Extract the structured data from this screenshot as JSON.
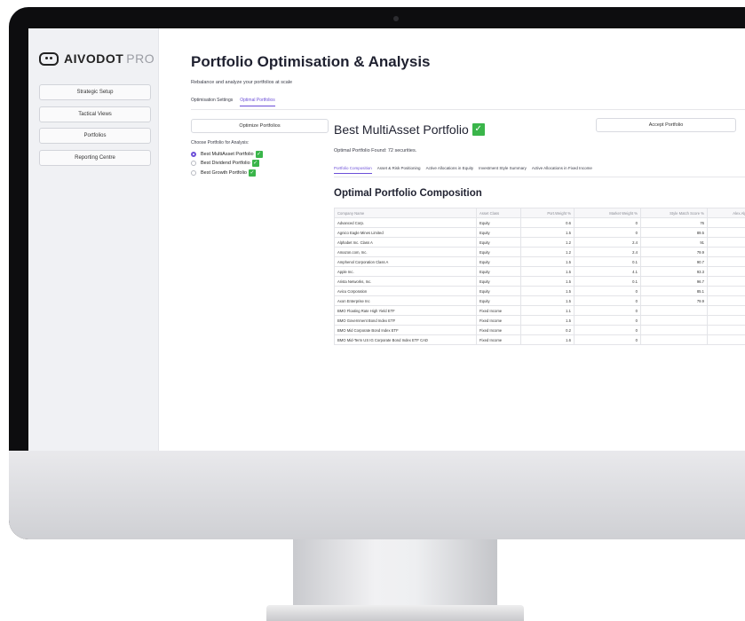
{
  "sidebar": {
    "logo_main": "AIVODOT",
    "logo_pro": "PRO",
    "items": [
      {
        "label": "Strategic Setup"
      },
      {
        "label": "Tactical Views"
      },
      {
        "label": "Portfolios"
      },
      {
        "label": "Reporting Centre"
      }
    ]
  },
  "header": {
    "title": "Portfolio Optimisation & Analysis",
    "subtitle": "Rebalance and analyze your portfolios at scale"
  },
  "tabs": [
    {
      "label": "Optimisation Settings",
      "active": false
    },
    {
      "label": "Optimal Portfolios",
      "active": true
    }
  ],
  "left_panel": {
    "optimize_button": "Optimize Portfolios",
    "choose_label": "Choose Portfolio for Analysis:",
    "options": [
      {
        "label": "Best MultiAsset Portfolio",
        "selected": true
      },
      {
        "label": "Best Dividend Portfolio",
        "selected": false
      },
      {
        "label": "Best Growth Portfolio",
        "selected": false
      }
    ]
  },
  "result": {
    "title": "Best MultiAsset Portfolio",
    "found_text": "Optimal Portfolio Found: 72 securities.",
    "accept_button": "Accept Portfolio",
    "sub_tabs": [
      {
        "label": "Portfolio Composition",
        "active": true
      },
      {
        "label": "Asset & Risk Positioning",
        "active": false
      },
      {
        "label": "Active Allocations in Equity",
        "active": false
      },
      {
        "label": "Investment Style Summary",
        "active": false
      },
      {
        "label": "Active Allocations in Fixed Income",
        "active": false
      }
    ],
    "section_title": "Optimal Portfolio Composition",
    "table": {
      "columns": [
        "Company Name",
        "Asset Class",
        "Port.Weight %",
        "Market Weight %",
        "Style Match Score %",
        "Alex.Alph"
      ],
      "rows": [
        [
          "Advanced Corp.",
          "Equity",
          "0.6",
          "0",
          "76",
          ""
        ],
        [
          "Agnico Eagle Mines Limited",
          "Equity",
          "1.5",
          "0",
          "89.5",
          ""
        ],
        [
          "Alphabet Inc. Class A",
          "Equity",
          "1.2",
          "2.4",
          "91",
          ""
        ],
        [
          "Amazon.com, Inc.",
          "Equity",
          "1.2",
          "2.4",
          "79.9",
          ""
        ],
        [
          "Amphenol Corporation Class A",
          "Equity",
          "1.5",
          "0.1",
          "90.7",
          ""
        ],
        [
          "Apple Inc.",
          "Equity",
          "1.5",
          "4.1",
          "93.3",
          ""
        ],
        [
          "Arista Networks, Inc.",
          "Equity",
          "1.5",
          "0.1",
          "96.7",
          ""
        ],
        [
          "Avicu Corporation",
          "Equity",
          "1.5",
          "0",
          "85.1",
          ""
        ],
        [
          "Axon Enterprise Inc",
          "Equity",
          "1.5",
          "0",
          "79.9",
          ""
        ],
        [
          "BMO Floating Rate High Yield ETF",
          "Fixed Income",
          "1.1",
          "0",
          "",
          ""
        ],
        [
          "BMO Government Bond Index ETF",
          "Fixed Income",
          "1.5",
          "0",
          "",
          ""
        ],
        [
          "BMO Mid Corporate Bond Index ETF",
          "Fixed Income",
          "0.2",
          "0",
          "",
          ""
        ],
        [
          "BMO Mid-Term US IG Corporate Bond Index ETF CAD",
          "Fixed Income",
          "1.6",
          "0",
          "",
          ""
        ]
      ]
    }
  },
  "colors": {
    "accent": "#6c4fd8",
    "check_green": "#3ab54a",
    "sidebar_bg": "#f0f1f4"
  }
}
